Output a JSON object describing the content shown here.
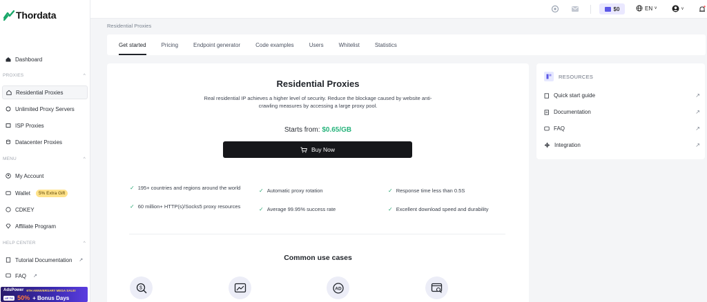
{
  "app": {
    "logo_text": "Thordata"
  },
  "sidebar": {
    "dashboard": "Dashboard",
    "sections": {
      "proxies": "PROXIES",
      "menu": "MENU",
      "help": "HELP CENTER"
    },
    "proxies_items": [
      "Residential Proxies",
      "Unlimited Proxy Servers",
      "ISP Proxies",
      "Datacenter Proxies"
    ],
    "menu_items": {
      "account": "My Account",
      "wallet": "Wallet",
      "wallet_badge": "5% Extra Gift",
      "cdkey": "CDKEY",
      "affiliate": "Affiliate Program"
    },
    "help_items": [
      "Tutorial Documentation",
      "FAQ"
    ],
    "promo": {
      "brand": "AdsPower",
      "subtitle": "6TH ANNIVERSARY MEGA SALE!",
      "upto": "UP TO",
      "pct": "50%",
      "bonus": "+ Bonus Days"
    }
  },
  "topbar": {
    "balance": "$0",
    "language": "EN"
  },
  "breadcrumb": "Residential Proxies",
  "tabs": [
    "Get started",
    "Pricing",
    "Endpoint generator",
    "Code examples",
    "Users",
    "Whitelist",
    "Statistics"
  ],
  "main": {
    "title": "Residential Proxies",
    "description": "Real residential IP achieves a higher level of security. Reduce the blockage caused by website anti-crawling measures by accessing a large proxy pool.",
    "starts_label": "Starts from:",
    "price": "$0.65/GB",
    "buy_label": "Buy Now",
    "features": [
      "195+ countries and regions around the world",
      "Automatic proxy rotation",
      "Response time less than 0.5S",
      "60 million+ HTTP(s)/Socks5 proxy resources",
      "Average 99.95% success rate",
      "Excellent download speed and durability"
    ],
    "use_cases_title": "Common use cases"
  },
  "resources": {
    "title": "RESOURCES",
    "items": [
      "Quick start guide",
      "Documentation",
      "FAQ",
      "Integration"
    ]
  },
  "colors": {
    "accent_green": "#26b37b",
    "button_dark": "#16171a",
    "balance_bg": "#eae8ff"
  }
}
